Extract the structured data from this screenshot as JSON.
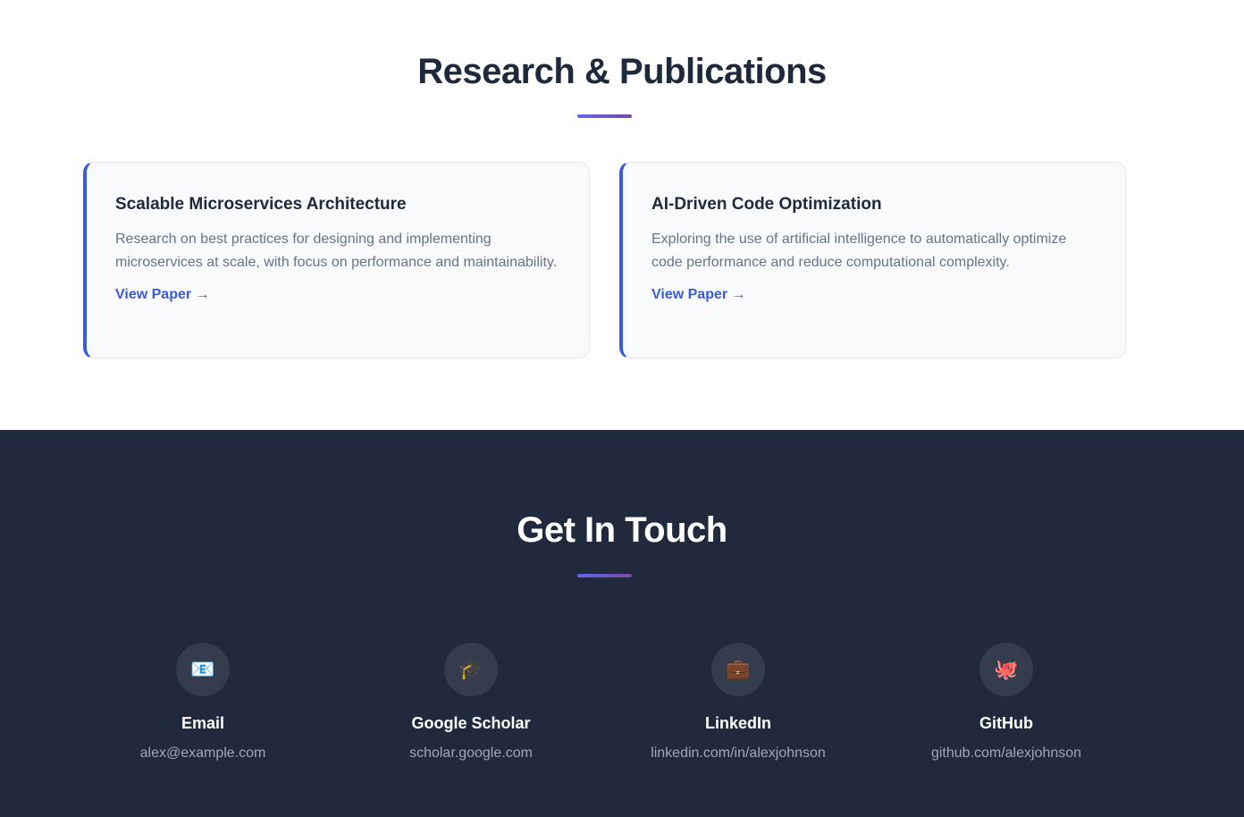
{
  "research": {
    "title": "Research & Publications",
    "papers": [
      {
        "title": "Scalable Microservices Architecture",
        "description": "Research on best practices for designing and implementing microservices at scale, with focus on performance and maintainability.",
        "link_label": "View Paper →"
      },
      {
        "title": "AI-Driven Code Optimization",
        "description": "Exploring the use of artificial intelligence to automatically optimize code performance and reduce computational complexity.",
        "link_label": "View Paper →"
      }
    ]
  },
  "contact": {
    "title": "Get In Touch",
    "items": [
      {
        "icon": "email-icon",
        "glyph": "📧",
        "label": "Email",
        "value": "alex@example.com"
      },
      {
        "icon": "graduation-cap-icon",
        "glyph": "🎓",
        "label": "Google Scholar",
        "value": "scholar.google.com"
      },
      {
        "icon": "briefcase-icon",
        "glyph": "💼",
        "label": "LinkedIn",
        "value": "linkedin.com/in/alexjohnson"
      },
      {
        "icon": "octopus-icon",
        "glyph": "🐙",
        "label": "GitHub",
        "value": "github.com/alexjohnson"
      }
    ]
  },
  "colors": {
    "accent": "#3b5bdb",
    "contact_bg": "#202a3c",
    "divider_start": "#6366f1",
    "divider_end": "#764ba2"
  }
}
